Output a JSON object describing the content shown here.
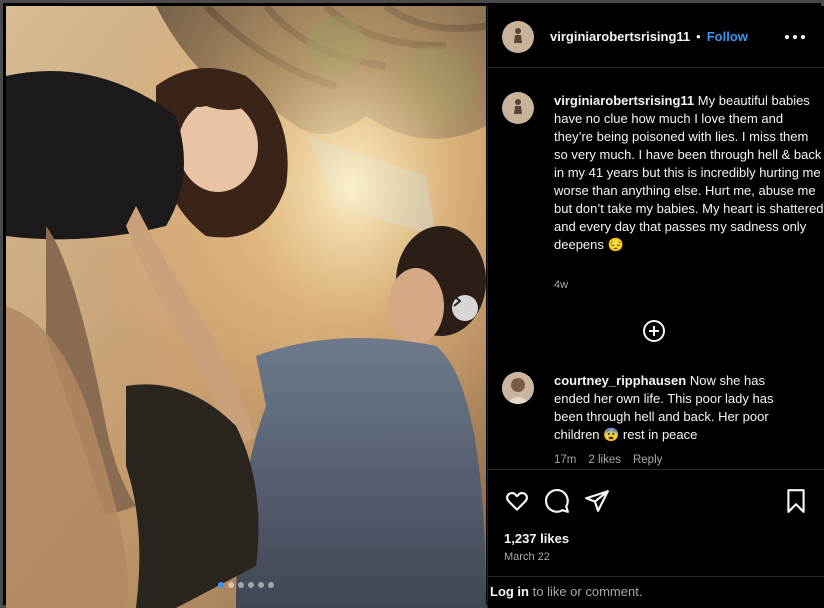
{
  "post": {
    "username": "virginiarobertsrising11",
    "separator": "•",
    "follow_label": "Follow",
    "more_icon": "more-horizontal-icon",
    "caption_text": "My beautiful babies have no clue how much I love them and they’re being poisoned with lies. I miss them so very much. I have been through hell & back in my 41 years but this is incredibly hurting me worse than anything else. Hurt me, abuse me but don’t take my babies. My heart is shattered and every day that passes my sadness only deepens 😔",
    "caption_time": "4w",
    "load_more_icon": "plus-circle-icon",
    "likes": "1,237 likes",
    "date": "March 22",
    "carousel": {
      "total": 6,
      "active_index": 0
    }
  },
  "comment": {
    "username": "courtney_ripphausen",
    "text": "Now she has ended her own life. This poor lady has been through hell and back. Her poor children 😨 rest in peace",
    "time": "17m",
    "likes": "2 likes",
    "reply_label": "Reply"
  },
  "actions": {
    "icons": [
      "heart-icon",
      "comment-icon",
      "share-icon",
      "bookmark-icon"
    ]
  },
  "login": {
    "login_label": "Log in",
    "suffix": " to like or comment."
  },
  "colors": {
    "accent": "#3797f0",
    "background": "#000000",
    "muted_text": "#a8a8a8"
  }
}
